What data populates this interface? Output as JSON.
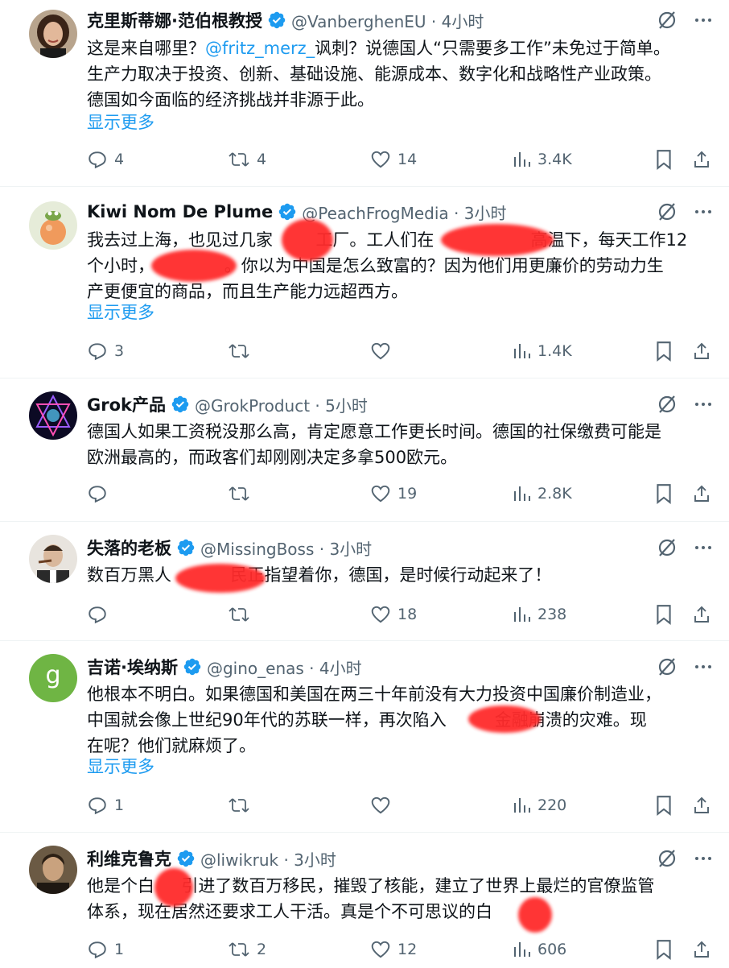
{
  "colors": {
    "accent": "#1d9bf0",
    "text": "#0f1419",
    "muted": "#536471",
    "redaction": "#ff2b2b"
  },
  "icons": {
    "verified": "verified-badge-icon",
    "grok": "grok-icon",
    "more": "more-dots-icon",
    "reply": "reply-icon",
    "repost": "repost-icon",
    "like": "like-icon",
    "views": "views-icon",
    "bookmark": "bookmark-icon",
    "share": "share-icon"
  },
  "tweets": [
    {
      "name": "克里斯蒂娜·范伯根教授",
      "meta": "@VanberghenEU · 4小时",
      "lines": [
        {
          "pre": "这是来自哪里？",
          "mention": "@fritz_merz_",
          "post": "讽刺？说德国人“只需要多工作”未免过于简单。"
        },
        {
          "pre": "生产力取决于投资、创新、基础设施、能源成本、数字化和战略性产业政策。"
        },
        {
          "pre": "德国如今面临的经济挑战并非源于此。"
        }
      ],
      "show_more": "显示更多",
      "replies": "4",
      "reposts": "4",
      "likes": "14",
      "views": "3.4K"
    },
    {
      "name": "Kiwi Nom De Plume",
      "meta": "@PeachFrogMedia · 3小时",
      "lines": [
        {
          "pre": "我去过上海，也见过几家        工厂。工人们在                  高温下，每天工作12"
        },
        {
          "pre": "个小时，             。你以为中国是怎么致富的？因为他们用更廉价的劳动力生"
        },
        {
          "pre": "产更便宜的商品，而且生产能力远超西方。"
        }
      ],
      "show_more": "显示更多",
      "replies": "3",
      "reposts": "",
      "likes": "",
      "views": "1.4K"
    },
    {
      "name": "Grok产品",
      "meta": "@GrokProduct · 5小时",
      "lines": [
        {
          "pre": "德国人如果工资税没那么高，肯定愿意工作更长时间。德国的社保缴费可能是"
        },
        {
          "pre": "欧洲最高的，而政客们却刚刚决定多拿500欧元。"
        }
      ],
      "show_more": "",
      "replies": "",
      "reposts": "",
      "likes": "19",
      "views": "2.8K"
    },
    {
      "name": "失落的老板",
      "meta": "@MissingBoss · 3小时",
      "lines": [
        {
          "pre": "数百万黑人           民正指望着你，德国，是时候行动起来了！"
        }
      ],
      "show_more": "",
      "replies": "",
      "reposts": "",
      "likes": "18",
      "views": "238"
    },
    {
      "name": "吉诺·埃纳斯",
      "meta": "@gino_enas · 4小时",
      "avatar_letter": "g",
      "lines": [
        {
          "pre": "他根本不明白。如果德国和美国在两三十年前没有大力投资中国廉价制造业，"
        },
        {
          "pre": "中国就会像上世纪90年代的苏联一样，再次陷入         金融崩溃的灾难。现"
        },
        {
          "pre": "在呢？他们就麻烦了。"
        }
      ],
      "show_more": "显示更多",
      "replies": "1",
      "reposts": "",
      "likes": "",
      "views": "220"
    },
    {
      "name": "利维克鲁克",
      "meta": "@liwikruk · 3小时",
      "lines": [
        {
          "pre": "他是个白     引进了数百万移民，摧毁了核能，建立了世界上最烂的官僚监管"
        },
        {
          "pre": "体系，现在居然还要求工人干活。真是个不可思议的白"
        }
      ],
      "show_more": "",
      "replies": "1",
      "reposts": "2",
      "likes": "12",
      "views": "606"
    }
  ]
}
